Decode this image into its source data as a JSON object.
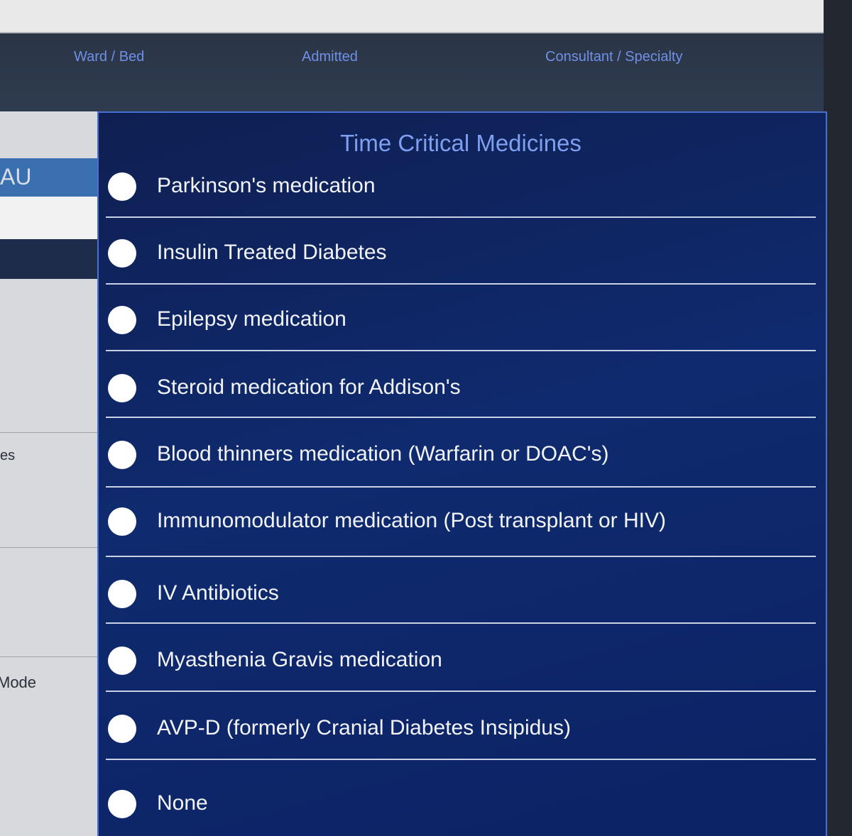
{
  "header": {
    "columns": [
      "Ward / Bed",
      "Admitted",
      "Consultant / Specialty"
    ]
  },
  "background": {
    "fragments": [
      "AU",
      "es",
      "Mode"
    ]
  },
  "modal": {
    "title": "Time Critical Medicines",
    "options": [
      {
        "label": "Parkinson's medication",
        "selected": false
      },
      {
        "label": "Insulin Treated Diabetes",
        "selected": false
      },
      {
        "label": "Epilepsy medication",
        "selected": false
      },
      {
        "label": "Steroid medication for Addison's",
        "selected": false
      },
      {
        "label": "Blood thinners medication (Warfarin or DOAC's)",
        "selected": false
      },
      {
        "label": "Immunomodulator medication (Post transplant or HIV)",
        "selected": false
      },
      {
        "label": "IV Antibiotics",
        "selected": false
      },
      {
        "label": "Myasthenia Gravis medication",
        "selected": false
      },
      {
        "label": "AVP-D (formerly Cranial Diabetes Insipidus)",
        "selected": false
      },
      {
        "label": "None",
        "selected": false
      }
    ]
  },
  "colors": {
    "modal_bg": "#0f2a6e",
    "modal_border": "#4a6fd1",
    "title_color": "#7f9ff0",
    "header_text": "#6f90e6"
  }
}
